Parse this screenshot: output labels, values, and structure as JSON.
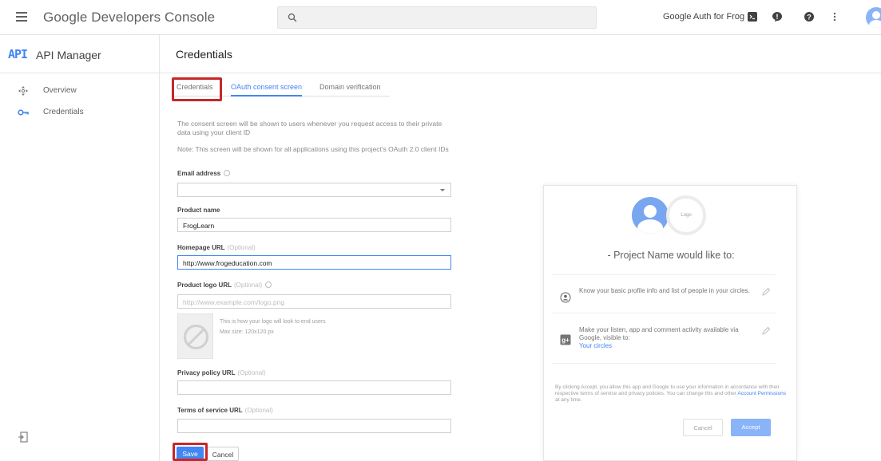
{
  "topbar": {
    "brand": "Google Developers Console",
    "project_name": "Google Auth for Frog"
  },
  "sidebar": {
    "logo": "API",
    "title": "API Manager",
    "items": [
      {
        "label": "Overview",
        "icon": "overview-icon"
      },
      {
        "label": "Credentials",
        "icon": "key-icon"
      }
    ]
  },
  "page": {
    "title": "Credentials"
  },
  "tabs": [
    {
      "label": "Credentials"
    },
    {
      "label": "OAuth consent screen"
    },
    {
      "label": "Domain verification"
    }
  ],
  "form": {
    "intro": "The consent screen will be shown to users whenever you request access to their private data using your client ID",
    "note": "Note: This screen will be shown for all applications using this project's OAuth 2.0 client IDs",
    "email_label": "Email address",
    "product_label": "Product name",
    "product_value": "FrogLearn",
    "homepage_label": "Homepage URL",
    "homepage_value": "http://www.frogeducation.com",
    "logo_label": "Product logo URL",
    "logo_placeholder": "http://www.example.com/logo.png",
    "logo_note": "This is how your logo will look to end users",
    "logo_size": "Max size: 120x120 px",
    "privacy_label": "Privacy policy URL",
    "terms_label": "Terms of service URL",
    "optional": "(Optional)",
    "save": "Save",
    "cancel": "Cancel"
  },
  "preview": {
    "logo_text": "Logo",
    "title": "- Project Name would like to:",
    "row1": "Know your basic profile info and list of people in your circles.",
    "row2": "Make your listen, app and comment activity available via Google, visible to:",
    "row2_link": "Your circles",
    "legal_a": "By clicking Accept, you allow this app and Google to use your information in accordance with their respective terms of service and privacy policies. You can change this and other ",
    "legal_link": "Account Permissions",
    "legal_b": " at any time.",
    "cancel": "Cancel",
    "accept": "Accept"
  },
  "colors": {
    "accent": "#4285f4",
    "highlight": "#c62828"
  }
}
